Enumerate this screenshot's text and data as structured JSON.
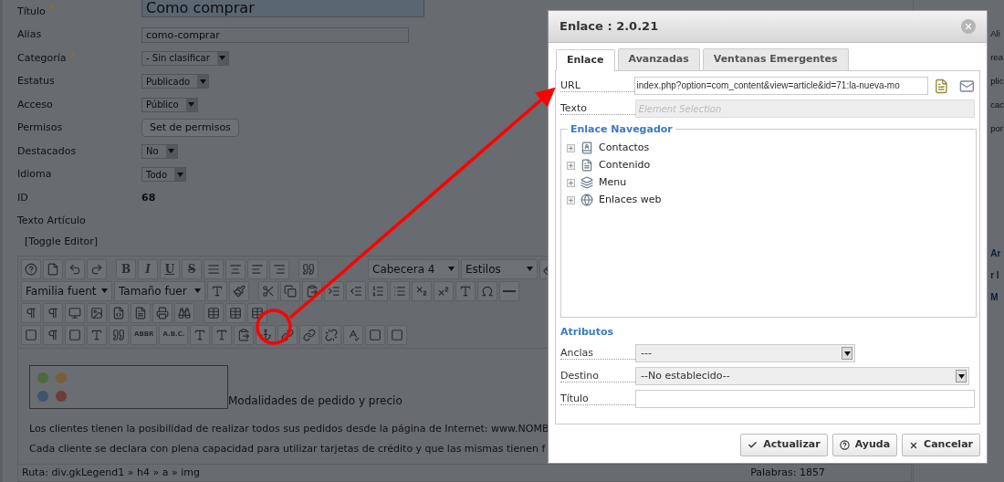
{
  "form": {
    "fields": [
      {
        "label": "Título",
        "required": true,
        "kind": "title",
        "value": "Como comprar"
      },
      {
        "label": "Alias",
        "required": false,
        "kind": "text",
        "value": "como-comprar"
      },
      {
        "label": "Categoría",
        "required": true,
        "kind": "select",
        "value": "- Sin clasificar"
      },
      {
        "label": "Estatus",
        "required": false,
        "kind": "select",
        "value": "Publicado"
      },
      {
        "label": "Acceso",
        "required": false,
        "kind": "select",
        "value": "Público"
      },
      {
        "label": "Permisos",
        "required": false,
        "kind": "button",
        "value": "Set de permisos"
      },
      {
        "label": "Destacados",
        "required": false,
        "kind": "select",
        "value": "No"
      },
      {
        "label": "Idioma",
        "required": false,
        "kind": "select",
        "value": "Todo"
      },
      {
        "label": "ID",
        "required": false,
        "kind": "static",
        "value": "68"
      },
      {
        "label": "Texto Artículo",
        "required": false,
        "kind": "none"
      }
    ]
  },
  "editor": {
    "toggle": "[Toggle Editor]",
    "format_buttons": [
      "B",
      "I",
      "U",
      "S"
    ],
    "selects": [
      "Cabecera 4",
      "Estilos",
      "Familia fuent",
      "Tamaño fuer"
    ],
    "text_buttons": [
      "ABBR",
      "A.B.C."
    ],
    "heading": "Modalidades de pedido y precio",
    "paragraphs": [
      "Los clientes tienen la posibilidad de realizar todos sus pedidos desde la página de Internet: www.NOMB",
      "Cada cliente se declara con plena capacidad para utilizar tarjetas de crédito y que las mismas tienen f"
    ],
    "path": "Ruta: div.gkLegend1 » h4 » a » img",
    "words": "Palabras: 1857"
  },
  "side": {
    "top_items": [
      "Ali",
      "rea",
      "plic",
      "cac",
      "por"
    ],
    "bottom_items": [
      "Ar",
      "r l",
      "M"
    ]
  },
  "dialog": {
    "title": "Enlace : 2.0.21",
    "tabs": [
      {
        "label": "Enlace",
        "selected": true
      },
      {
        "label": "Avanzadas",
        "selected": false
      },
      {
        "label": "Ventanas Emergentes",
        "selected": false
      }
    ],
    "url_label": "URL",
    "url_value": "index.php?option=com_content&view=article&id=71:la-nueva-mo",
    "text_label": "Texto",
    "text_placeholder": "Element Selection",
    "browser_title": "Enlace Navegador",
    "tree": [
      {
        "label": "Contactos",
        "expanded": false
      },
      {
        "label": "Contenido",
        "expanded": false
      },
      {
        "label": "Menu",
        "expanded": false
      },
      {
        "label": "Enlaces web",
        "expanded": false
      }
    ],
    "attributes_title": "Atributos",
    "attributes": [
      {
        "label": "Anclas",
        "kind": "select",
        "value": "---"
      },
      {
        "label": "Destino",
        "kind": "select",
        "value": "--No establecido--"
      },
      {
        "label": "Título",
        "kind": "input"
      }
    ],
    "buttons": [
      {
        "label": "Actualizar",
        "kind": "update"
      },
      {
        "label": "Ayuda",
        "kind": "help"
      },
      {
        "label": "Cancelar",
        "kind": "cancel"
      }
    ]
  }
}
